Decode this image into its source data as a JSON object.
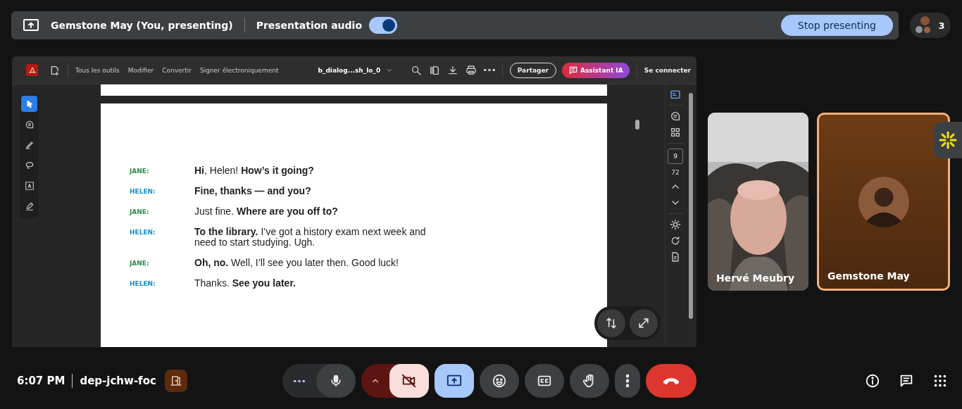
{
  "top_bar": {
    "presenter": "Gemstone May (You, presenting)",
    "audio_label": "Presentation audio",
    "audio_on": true,
    "stop_button": "Stop presenting",
    "participant_count": "3"
  },
  "pdf_viewer": {
    "menu": [
      "Tous les outils",
      "Modifier",
      "Convertir",
      "Signer électroniquement"
    ],
    "file_name": "b_dialog...sh_lo_0",
    "share_button": "Partager",
    "ai_button": "Assistant IA",
    "sign_in": "Se connecter",
    "tools": [
      {
        "kind": "select",
        "selected": true
      },
      {
        "kind": "comment",
        "selected": false
      },
      {
        "kind": "draw",
        "selected": false
      },
      {
        "kind": "lasso",
        "selected": false
      },
      {
        "kind": "text",
        "selected": false
      },
      {
        "kind": "sign",
        "selected": false
      }
    ],
    "page_number": "9",
    "page_total": "72",
    "dialogue": [
      {
        "speaker": "JANE:",
        "color": "#2f8a4c",
        "text": "**Hi**, Helen! **How’s it going?**"
      },
      {
        "speaker": "HELEN:",
        "color": "#1b8ec4",
        "text": "**Fine, thanks — and you?**"
      },
      {
        "speaker": "JANE:",
        "color": "#2f8a4c",
        "text": "Just fine. **Where are you off to?**"
      },
      {
        "speaker": "HELEN:",
        "color": "#1b8ec4",
        "text": "**To the library.** I’ve got a history exam next week and need to start studying. Ugh."
      },
      {
        "speaker": "JANE:",
        "color": "#2f8a4c",
        "text": "**Oh, no.** Well, I’ll see you later then. Good luck!"
      },
      {
        "speaker": "HELEN:",
        "color": "#1b8ec4",
        "text": "Thanks. **See you later.**"
      }
    ]
  },
  "tiles": [
    {
      "name": "Hervé Meubry",
      "kind": "video",
      "speaking": false
    },
    {
      "name": "Gemstone May",
      "kind": "avatar",
      "speaking": true
    }
  ],
  "bottom_bar": {
    "time": "6:07 PM",
    "meeting_code": "dep-jchw-foc",
    "mic_on": true,
    "camera_on": false,
    "presenting": true
  }
}
